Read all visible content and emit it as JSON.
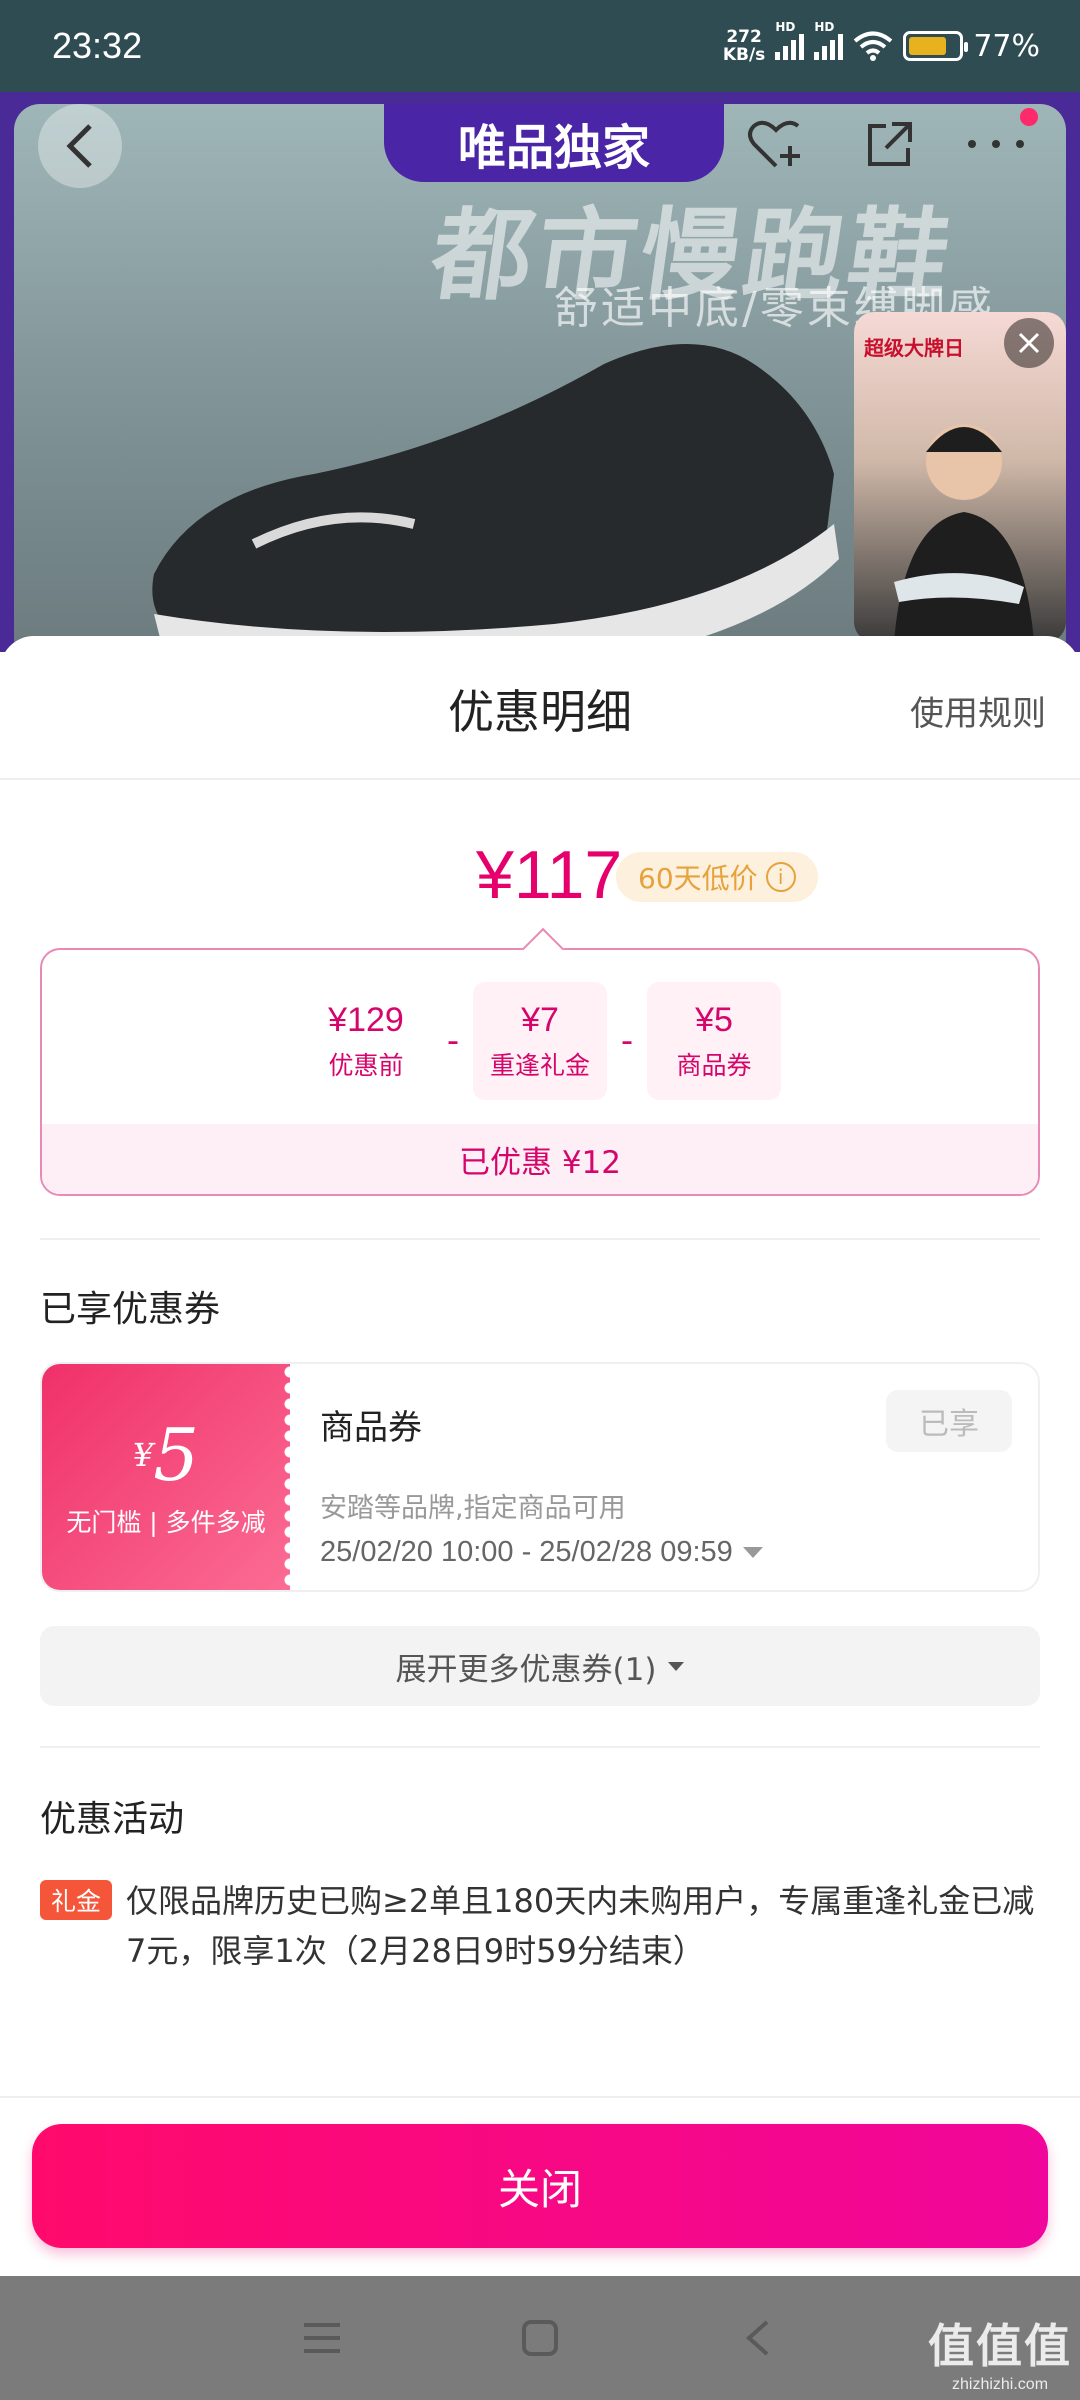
{
  "status_bar": {
    "time": "23:32",
    "net_speed_value": "272",
    "net_speed_unit": "KB/s",
    "battery": "77%",
    "battery_level": 0.77
  },
  "banner": {
    "tag": "唯品独家",
    "headline": "都市慢跑鞋",
    "subline": "舒适中底/零束缚脚感",
    "live_title": "超级大牌日"
  },
  "sheet": {
    "title": "优惠明细",
    "rules_link": "使用规则",
    "final_price": "¥117",
    "low_price_badge": "60天低价",
    "breakdown": {
      "items": [
        {
          "value": "¥129",
          "label": "优惠前"
        },
        {
          "value": "¥7",
          "label": "重逢礼金"
        },
        {
          "value": "¥5",
          "label": "商品券"
        }
      ],
      "operator": "-",
      "total": "已优惠 ¥12"
    },
    "coupons_section_title": "已享优惠券",
    "coupon": {
      "yen": "¥",
      "amount": "5",
      "condition": "无门槛 | 多件多减",
      "name": "商品券",
      "status": "已享",
      "description": "安踏等品牌,指定商品可用",
      "validity": "25/02/20 10:00 - 25/02/28 09:59"
    },
    "expand_button": "展开更多优惠券(1)",
    "activity_section_title": "优惠活动",
    "activity": {
      "tag": "礼金",
      "text": "仅限品牌历史已购≥2单且180天内未购用户，专属重逢礼金已减7元，限享1次（2月28日9时59分结束）"
    },
    "close_button": "关闭"
  },
  "watermark": {
    "main": "值值值",
    "site": "zhizhizhi.com"
  },
  "colors": {
    "accent": "#e6006b",
    "banner_purple": "#4a25a5",
    "tag_red": "#f5563a"
  }
}
